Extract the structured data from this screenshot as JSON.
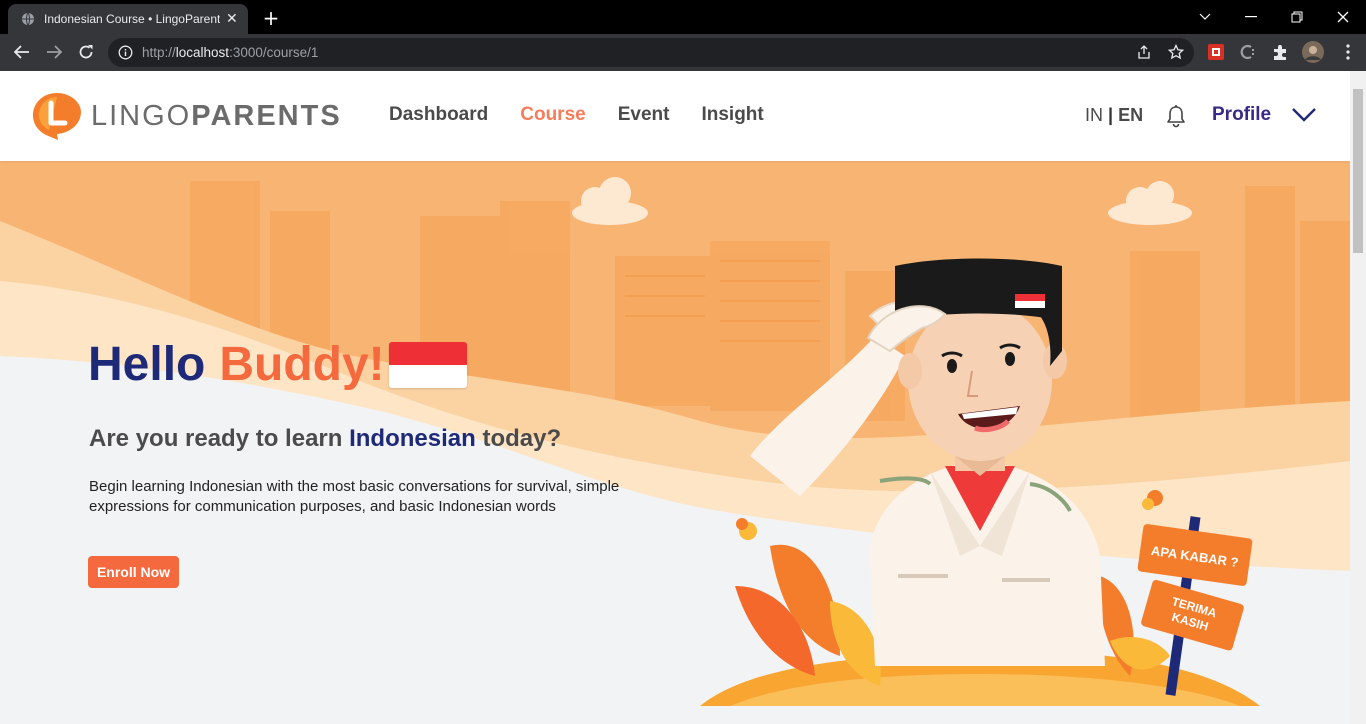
{
  "browser": {
    "tab_title": "Indonesian Course • LingoParent",
    "url_scheme": "http://",
    "url_host": "localhost",
    "url_path": ":3000/course/1"
  },
  "header": {
    "logo_part1": "LINGO",
    "logo_part2": "PARENTS",
    "nav": [
      {
        "label": "Dashboard",
        "active": false
      },
      {
        "label": "Course",
        "active": true
      },
      {
        "label": "Event",
        "active": false
      },
      {
        "label": "Insight",
        "active": false
      }
    ],
    "lang_in": "IN",
    "lang_sep": "|",
    "lang_en": "EN",
    "profile_label": "Profile"
  },
  "hero": {
    "hello": "Hello",
    "buddy": "Buddy!",
    "ready_prefix": "Are you ready to learn ",
    "ready_highlight": "Indonesian",
    "ready_suffix": " today?",
    "description": "Begin learning Indonesian with the most basic conversations for survival, simple expressions for communication purposes, and basic Indonesian words",
    "enroll_label": "Enroll Now",
    "sign_top": "APA KABAR ?",
    "sign_bottom_1": "TERIMA",
    "sign_bottom_2": "KASIH"
  },
  "colors": {
    "accent": "#f4693e",
    "navy": "#1e2a78",
    "profile": "#3a2a86"
  }
}
